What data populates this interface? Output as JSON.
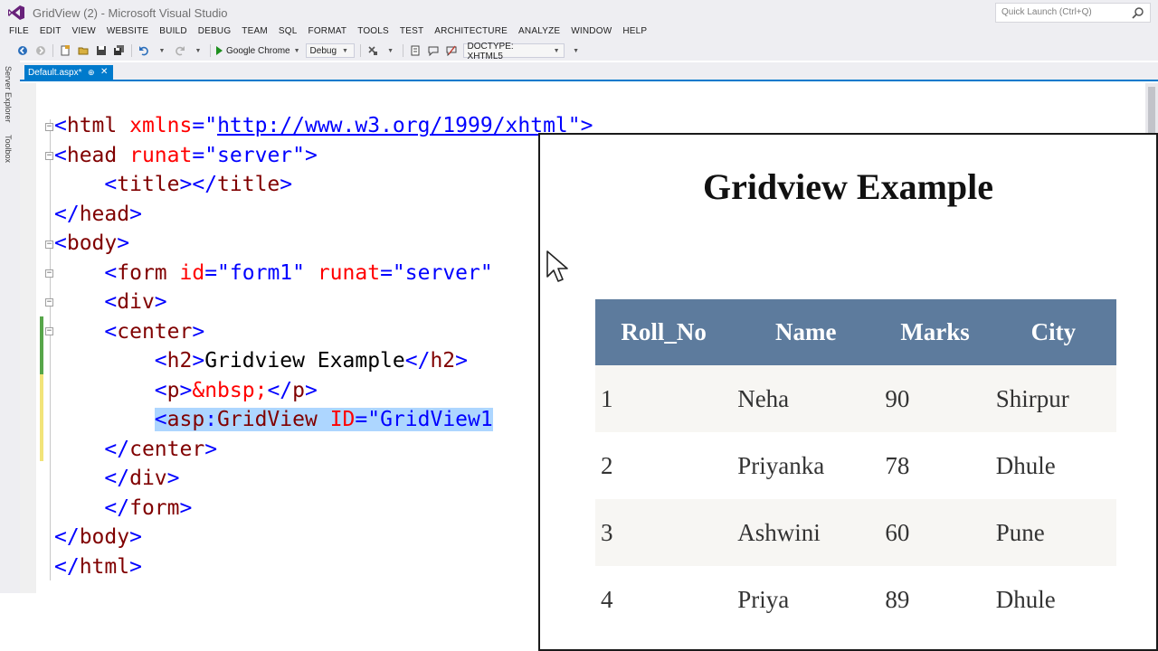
{
  "window": {
    "title": "GridView (2) - Microsoft Visual Studio",
    "quick_launch_placeholder": "Quick Launch (Ctrl+Q)"
  },
  "menu": [
    "FILE",
    "EDIT",
    "VIEW",
    "WEBSITE",
    "BUILD",
    "DEBUG",
    "TEAM",
    "SQL",
    "FORMAT",
    "TOOLS",
    "TEST",
    "ARCHITECTURE",
    "ANALYZE",
    "WINDOW",
    "HELP"
  ],
  "toolbar": {
    "run_target": "Google Chrome",
    "configuration": "Debug",
    "doctype": "DOCTYPE: XHTML5"
  },
  "side_panels": [
    "Server Explorer",
    "Toolbox"
  ],
  "tab": {
    "name": "Default.aspx*",
    "pin": "⊕",
    "close": "✕"
  },
  "code": [
    [
      {
        "t": "<",
        "c": "br"
      },
      {
        "t": "html",
        "c": "tag"
      },
      {
        "t": " ",
        "c": "txt"
      },
      {
        "t": "xmlns",
        "c": "attr"
      },
      {
        "t": "=\"",
        "c": "val"
      },
      {
        "t": "http://www.w3.org/1999/xhtml",
        "c": "url"
      },
      {
        "t": "\">",
        "c": "val"
      }
    ],
    [
      {
        "t": "<",
        "c": "br"
      },
      {
        "t": "head",
        "c": "tag"
      },
      {
        "t": " ",
        "c": "txt"
      },
      {
        "t": "runat",
        "c": "attr"
      },
      {
        "t": "=\"server\">",
        "c": "val"
      }
    ],
    [
      {
        "t": "    <",
        "c": "br"
      },
      {
        "t": "title",
        "c": "tag"
      },
      {
        "t": "></",
        "c": "br"
      },
      {
        "t": "title",
        "c": "tag"
      },
      {
        "t": ">",
        "c": "br"
      }
    ],
    [
      {
        "t": "</",
        "c": "br"
      },
      {
        "t": "head",
        "c": "tag"
      },
      {
        "t": ">",
        "c": "br"
      }
    ],
    [
      {
        "t": "<",
        "c": "br"
      },
      {
        "t": "body",
        "c": "tag"
      },
      {
        "t": ">",
        "c": "br"
      }
    ],
    [
      {
        "t": "    <",
        "c": "br"
      },
      {
        "t": "form",
        "c": "tag"
      },
      {
        "t": " ",
        "c": "txt"
      },
      {
        "t": "id",
        "c": "attr"
      },
      {
        "t": "=\"form1\" ",
        "c": "val"
      },
      {
        "t": "runat",
        "c": "attr"
      },
      {
        "t": "=\"server\"",
        "c": "val"
      }
    ],
    [
      {
        "t": "    <",
        "c": "br"
      },
      {
        "t": "div",
        "c": "tag"
      },
      {
        "t": ">",
        "c": "br"
      }
    ],
    [
      {
        "t": "    <",
        "c": "br"
      },
      {
        "t": "center",
        "c": "tag"
      },
      {
        "t": ">",
        "c": "br"
      }
    ],
    [
      {
        "t": "        <",
        "c": "br"
      },
      {
        "t": "h2",
        "c": "tag"
      },
      {
        "t": ">",
        "c": "br"
      },
      {
        "t": "Gridview Example",
        "c": "txt"
      },
      {
        "t": "</",
        "c": "br"
      },
      {
        "t": "h2",
        "c": "tag"
      },
      {
        "t": ">",
        "c": "br"
      }
    ],
    [
      {
        "t": "        <",
        "c": "br"
      },
      {
        "t": "p",
        "c": "tag"
      },
      {
        "t": ">",
        "c": "br"
      },
      {
        "t": "&nbsp;",
        "c": "attr"
      },
      {
        "t": "</",
        "c": "br"
      },
      {
        "t": "p",
        "c": "tag"
      },
      {
        "t": ">",
        "c": "br"
      }
    ],
    [
      {
        "t": "        <",
        "c": "br"
      },
      {
        "t": "asp",
        "c": "tag"
      },
      {
        "t": ":",
        "c": "br"
      },
      {
        "t": "GridView",
        "c": "tag"
      },
      {
        "t": " ",
        "c": "txt"
      },
      {
        "t": "ID",
        "c": "attr"
      },
      {
        "t": "=\"GridView1",
        "c": "val"
      }
    ],
    [
      {
        "t": "    </",
        "c": "br"
      },
      {
        "t": "center",
        "c": "tag"
      },
      {
        "t": ">",
        "c": "br"
      }
    ],
    [
      {
        "t": "    </",
        "c": "br"
      },
      {
        "t": "div",
        "c": "tag"
      },
      {
        "t": ">",
        "c": "br"
      }
    ],
    [
      {
        "t": "    </",
        "c": "br"
      },
      {
        "t": "form",
        "c": "tag"
      },
      {
        "t": ">",
        "c": "br"
      }
    ],
    [
      {
        "t": "</",
        "c": "br"
      },
      {
        "t": "body",
        "c": "tag"
      },
      {
        "t": ">",
        "c": "br"
      }
    ],
    [
      {
        "t": "</",
        "c": "br"
      },
      {
        "t": "html",
        "c": "tag"
      },
      {
        "t": ">",
        "c": "br"
      }
    ]
  ],
  "preview": {
    "heading": "Gridview Example",
    "columns": [
      "Roll_No",
      "Name",
      "Marks",
      "City"
    ],
    "rows": [
      [
        "1",
        "Neha",
        "90",
        "Shirpur"
      ],
      [
        "2",
        "Priyanka",
        "78",
        "Dhule"
      ],
      [
        "3",
        "Ashwini",
        "60",
        "Pune"
      ],
      [
        "4",
        "Priya",
        "89",
        "Dhule"
      ]
    ]
  },
  "colors": {
    "accent": "#007acc",
    "grid_header": "#5d7b9d",
    "grid_alt_row": "#f7f6f3",
    "selection": "#add6ff"
  }
}
